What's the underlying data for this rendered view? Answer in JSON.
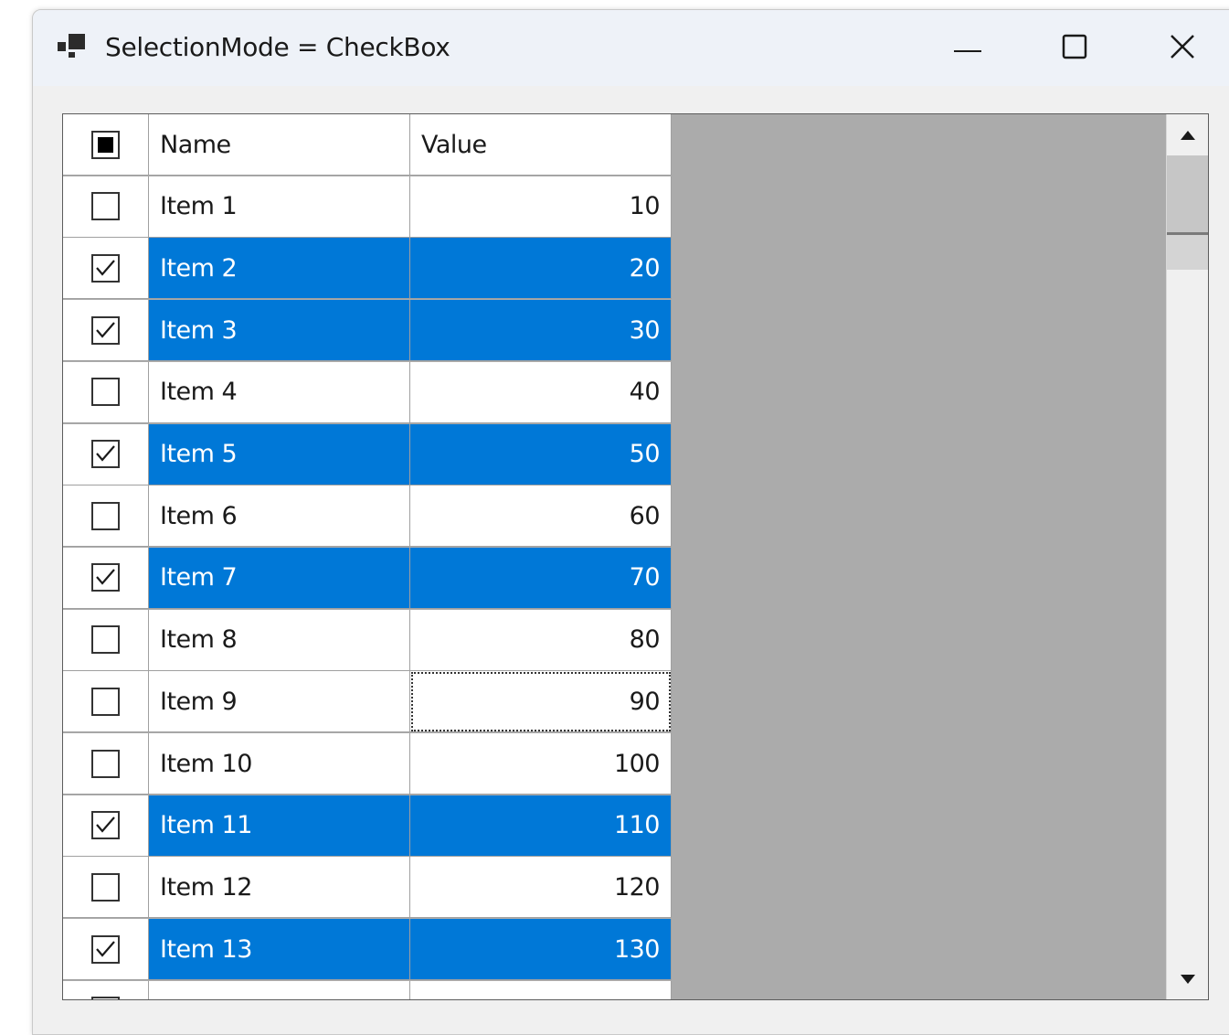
{
  "window": {
    "title": "SelectionMode = CheckBox"
  },
  "grid": {
    "columns": [
      "",
      "Name",
      "Value"
    ],
    "header_checkbox_state": "indeterminate",
    "focused_row": 9,
    "selection_color": "#0078d7",
    "rows": [
      {
        "name": "Item 1",
        "value": "10",
        "checked": false
      },
      {
        "name": "Item 2",
        "value": "20",
        "checked": true
      },
      {
        "name": "Item 3",
        "value": "30",
        "checked": true
      },
      {
        "name": "Item 4",
        "value": "40",
        "checked": false
      },
      {
        "name": "Item 5",
        "value": "50",
        "checked": true
      },
      {
        "name": "Item 6",
        "value": "60",
        "checked": false
      },
      {
        "name": "Item 7",
        "value": "70",
        "checked": true
      },
      {
        "name": "Item 8",
        "value": "80",
        "checked": false
      },
      {
        "name": "Item 9",
        "value": "90",
        "checked": false
      },
      {
        "name": "Item 10",
        "value": "100",
        "checked": false
      },
      {
        "name": "Item 11",
        "value": "110",
        "checked": true
      },
      {
        "name": "Item 12",
        "value": "120",
        "checked": false
      },
      {
        "name": "Item 13",
        "value": "130",
        "checked": true
      },
      {
        "name": "",
        "value": "",
        "checked": false
      }
    ]
  },
  "icons": {
    "app": "app-window-icon",
    "minimize": "minimize-icon",
    "maximize": "maximize-icon",
    "close": "close-icon",
    "scroll_up": "arrow-up-icon",
    "scroll_down": "arrow-down-icon",
    "check": "checkmark-icon"
  }
}
